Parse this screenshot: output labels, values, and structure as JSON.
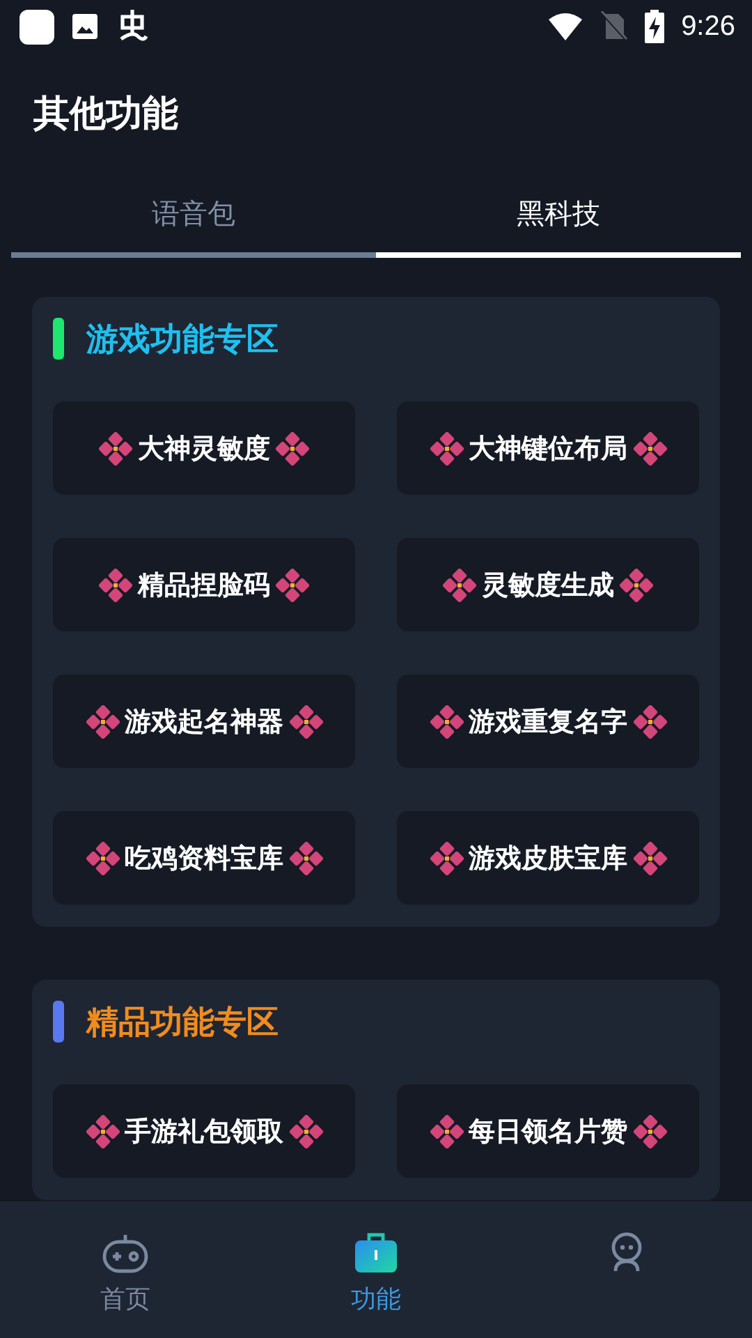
{
  "status_bar": {
    "time": "9:26"
  },
  "header": {
    "title": "其他功能"
  },
  "tabs": [
    {
      "label": "语音包",
      "selected": false
    },
    {
      "label": "黑科技",
      "selected": true
    }
  ],
  "sections": [
    {
      "title": "游戏功能专区",
      "kind": "games",
      "color": "#1ee66e",
      "items": [
        "大神灵敏度",
        "大神键位布局",
        "精品捏脸码",
        "灵敏度生成",
        "游戏起名神器",
        "游戏重复名字",
        "吃鸡资料宝库",
        "游戏皮肤宝库"
      ]
    },
    {
      "title": "精品功能专区",
      "kind": "premium",
      "color": "#5a78f0",
      "items": [
        "手游礼包领取",
        "每日领名片赞"
      ]
    }
  ],
  "bottom_nav": [
    {
      "kind": "gamepad",
      "label": "首页",
      "selected": false
    },
    {
      "kind": "briefcase",
      "label": "功能",
      "selected": true
    },
    {
      "kind": "person",
      "selected": false
    }
  ]
}
